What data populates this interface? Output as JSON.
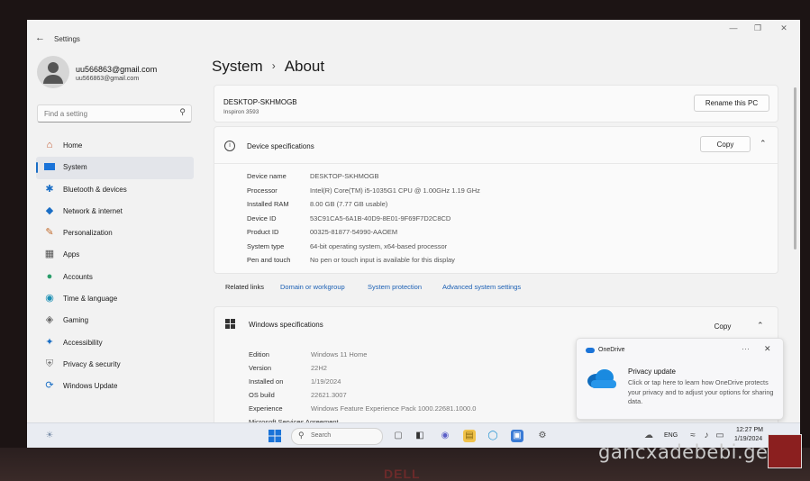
{
  "window": {
    "title": "Settings"
  },
  "user": {
    "name": "uu566863@gmail.com",
    "email": "uu566863@gmail.com"
  },
  "search": {
    "placeholder": "Find a setting"
  },
  "nav": [
    {
      "label": "Home",
      "icon": "home-icon",
      "active": false
    },
    {
      "label": "System",
      "icon": "system-icon",
      "active": true
    },
    {
      "label": "Bluetooth & devices",
      "icon": "bluetooth-icon",
      "active": false
    },
    {
      "label": "Network & internet",
      "icon": "network-icon",
      "active": false
    },
    {
      "label": "Personalization",
      "icon": "brush-icon",
      "active": false
    },
    {
      "label": "Apps",
      "icon": "apps-icon",
      "active": false
    },
    {
      "label": "Accounts",
      "icon": "accounts-icon",
      "active": false
    },
    {
      "label": "Time & language",
      "icon": "globe-icon",
      "active": false
    },
    {
      "label": "Gaming",
      "icon": "gamepad-icon",
      "active": false
    },
    {
      "label": "Accessibility",
      "icon": "accessibility-icon",
      "active": false
    },
    {
      "label": "Privacy & security",
      "icon": "shield-icon",
      "active": false
    },
    {
      "label": "Windows Update",
      "icon": "update-icon",
      "active": false
    }
  ],
  "page": {
    "section": "System",
    "title": "About"
  },
  "pc": {
    "name": "DESKTOP-SKHMOGB",
    "model": "Inspiron 3593",
    "rename_label": "Rename this PC"
  },
  "device_specs": {
    "title": "Device specifications",
    "copy_label": "Copy",
    "rows": [
      {
        "key": "Device name",
        "value": "DESKTOP-SKHMOGB"
      },
      {
        "key": "Processor",
        "value": "Intel(R) Core(TM) i5-1035G1 CPU @ 1.00GHz   1.19 GHz"
      },
      {
        "key": "Installed RAM",
        "value": "8.00 GB (7.77 GB usable)"
      },
      {
        "key": "Device ID",
        "value": "53C91CA5-6A1B-40D9-8E01-9F69F7D2C8CD"
      },
      {
        "key": "Product ID",
        "value": "00325-81877-54990-AAOEM"
      },
      {
        "key": "System type",
        "value": "64-bit operating system, x64-based processor"
      },
      {
        "key": "Pen and touch",
        "value": "No pen or touch input is available for this display"
      }
    ]
  },
  "related": {
    "label": "Related links",
    "links": [
      "Domain or workgroup",
      "System protection",
      "Advanced system settings"
    ]
  },
  "windows_specs": {
    "title": "Windows specifications",
    "copy_label": "Copy",
    "rows": [
      {
        "key": "Edition",
        "value": "Windows 11 Home"
      },
      {
        "key": "Version",
        "value": "22H2"
      },
      {
        "key": "Installed on",
        "value": "1/19/2024"
      },
      {
        "key": "OS build",
        "value": "22621.3007"
      },
      {
        "key": "Experience",
        "value": "Windows Feature Experience Pack 1000.22681.1000.0"
      },
      {
        "key": "Microsoft Services Agreement",
        "value": ""
      }
    ]
  },
  "toast": {
    "app": "OneDrive",
    "title": "Privacy update",
    "body": "Click or tap here to learn how OneDrive protects your privacy and to adjust your options for sharing data."
  },
  "taskbar": {
    "search_placeholder": "Search",
    "lang": "ENG",
    "time": "12:27 PM",
    "date": "1/19/2024"
  },
  "watermark": "gancxadebebi.ge",
  "laptop_brand": "DELL",
  "colors": {
    "accent": "#1a6ec5",
    "link": "#1a5fb4",
    "background": "#f2f2f2"
  }
}
